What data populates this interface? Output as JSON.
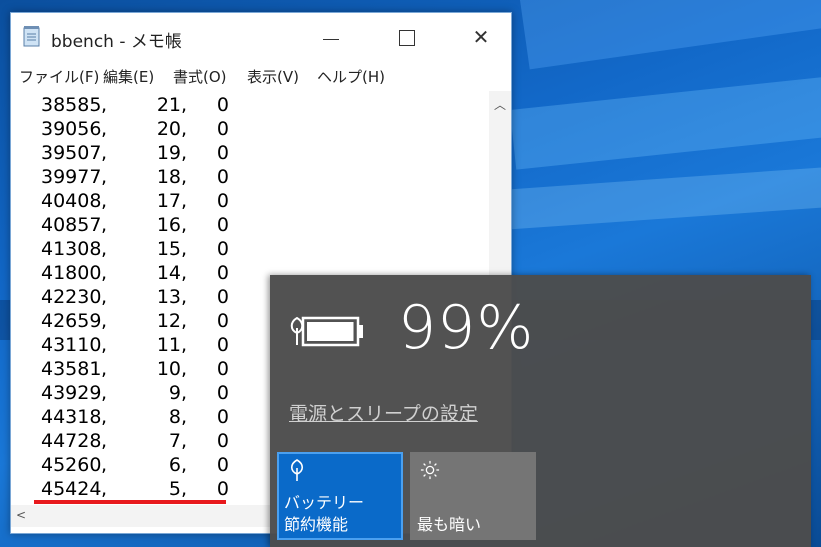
{
  "notepad": {
    "title": "bbench - メモ帳",
    "menu": [
      "ファイル(F)",
      "編集(E)",
      "書式(O)",
      "表示(V)",
      "ヘルプ(H)"
    ],
    "lines": [
      [
        "38585",
        "21",
        "0"
      ],
      [
        "39056",
        "20",
        "0"
      ],
      [
        "39507",
        "19",
        "0"
      ],
      [
        "39977",
        "18",
        "0"
      ],
      [
        "40408",
        "17",
        "0"
      ],
      [
        "40857",
        "16",
        "0"
      ],
      [
        "41308",
        "15",
        "0"
      ],
      [
        "41800",
        "14",
        "0"
      ],
      [
        "42230",
        "13",
        "0"
      ],
      [
        "42659",
        "12",
        "0"
      ],
      [
        "43110",
        "11",
        "0"
      ],
      [
        "43581",
        "10",
        "0"
      ],
      [
        "43929",
        "9",
        "0"
      ],
      [
        "44318",
        "8",
        "0"
      ],
      [
        "44728",
        "7",
        "0"
      ],
      [
        "45260",
        "6",
        "0"
      ],
      [
        "45424",
        "5",
        "0"
      ]
    ],
    "highlight_color": "#e8191d"
  },
  "battery_flyout": {
    "percent_label": "99%",
    "battery_level": 0.99,
    "power_settings_link": "電源とスリープの設定",
    "tiles": [
      {
        "label_line1": "バッテリー",
        "label_line2": "節約機能",
        "icon": "leaf-icon",
        "active": true,
        "color": "#0a6ac9"
      },
      {
        "label_line1": "最も暗い",
        "icon": "brightness-icon",
        "active": false,
        "color": "#757575"
      }
    ]
  }
}
